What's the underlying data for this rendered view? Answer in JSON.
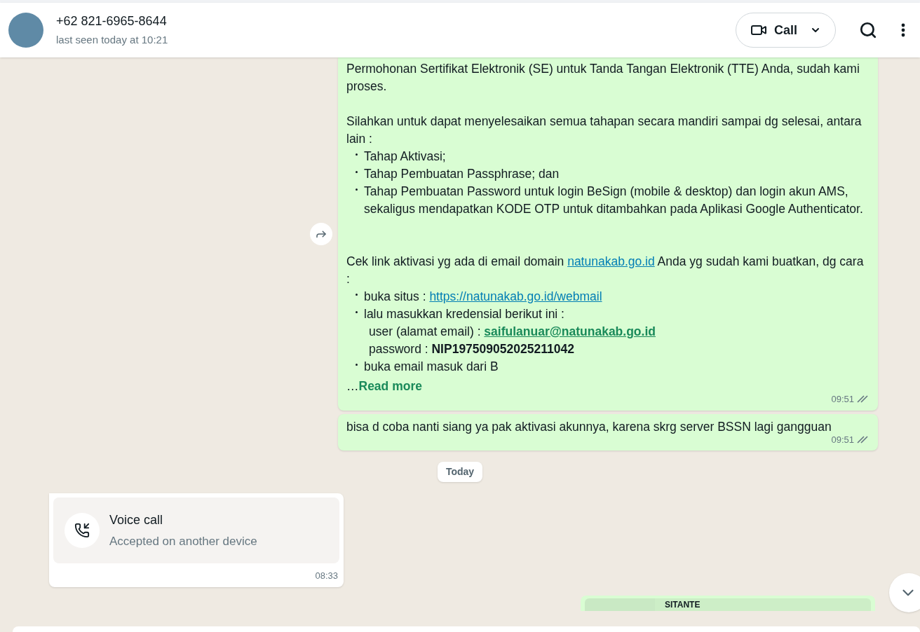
{
  "header": {
    "contact_name": "+62 821-6965-8644",
    "status": "last seen today at 10:21",
    "call_button": "Call"
  },
  "messages": [
    {
      "kind": "outgoing",
      "forward": true,
      "blocks": [
        {
          "kind": "para",
          "segments": [
            {
              "kind": "text",
              "text": "Permohonan Sertifikat Elektronik (SE) untuk Tanda Tangan Elektronik (TTE) Anda, sudah kami proses."
            }
          ]
        },
        {
          "kind": "gap"
        },
        {
          "kind": "para",
          "segments": [
            {
              "kind": "text",
              "text": "Silahkan untuk dapat menyelesaikan semua tahapan secara mandiri sampai dg selesai, antara lain :"
            }
          ]
        },
        {
          "kind": "bullet",
          "segments": [
            {
              "kind": "text",
              "text": "Tahap Aktivasi;"
            }
          ]
        },
        {
          "kind": "bullet",
          "segments": [
            {
              "kind": "text",
              "text": "Tahap Pembuatan Passphrase; dan"
            }
          ]
        },
        {
          "kind": "bullet",
          "segments": [
            {
              "kind": "text",
              "text": "Tahap Pembuatan Password untuk login BeSign (mobile & desktop) dan login akun AMS, sekaligus mendapatkan KODE OTP untuk ditambahkan pada Aplikasi Google Authenticator."
            }
          ]
        },
        {
          "kind": "gap"
        },
        {
          "kind": "gap"
        },
        {
          "kind": "para",
          "segments": [
            {
              "kind": "text",
              "text": "Cek link aktivasi yg ada di email domain "
            },
            {
              "kind": "link",
              "text": "natunakab.go.id"
            },
            {
              "kind": "text",
              "text": " Anda yg sudah kami buatkan, dg cara :"
            }
          ]
        },
        {
          "kind": "bullet",
          "segments": [
            {
              "kind": "text",
              "text": "buka situs : "
            },
            {
              "kind": "link",
              "text": "https://natunakab.go.id/webmail"
            }
          ]
        },
        {
          "kind": "bullet",
          "segments": [
            {
              "kind": "text",
              "text": "lalu masukkan kredensial berikut ini :"
            }
          ]
        },
        {
          "kind": "indent",
          "segments": [
            {
              "kind": "text",
              "text": "user (alamat email) : "
            },
            {
              "kind": "bold_link",
              "text": "saifulanuar@natunakab.go.id"
            }
          ]
        },
        {
          "kind": "indent",
          "segments": [
            {
              "kind": "text",
              "text": "password : "
            },
            {
              "kind": "bold",
              "text": "NIP197509052025211042"
            }
          ]
        },
        {
          "kind": "bullet",
          "segments": [
            {
              "kind": "text",
              "text": "buka email masuk dari B"
            }
          ]
        }
      ],
      "read_more": {
        "ellipsis": "…",
        "label": "Read more"
      },
      "time": "09:51",
      "read": false
    },
    {
      "kind": "outgoing",
      "forward": false,
      "blocks": [
        {
          "kind": "para",
          "segments": [
            {
              "kind": "text",
              "text": "bisa d coba nanti siang ya pak aktivasi akunnya, karena skrg server BSSN lagi gangguan"
            }
          ]
        }
      ],
      "time": "09:51",
      "read": false
    },
    {
      "kind": "date",
      "label": "Today"
    },
    {
      "kind": "call",
      "title": "Voice call",
      "subtitle": "Accepted on another device",
      "time": "08:33"
    },
    {
      "kind": "partial",
      "title": "SITANTE"
    }
  ]
}
